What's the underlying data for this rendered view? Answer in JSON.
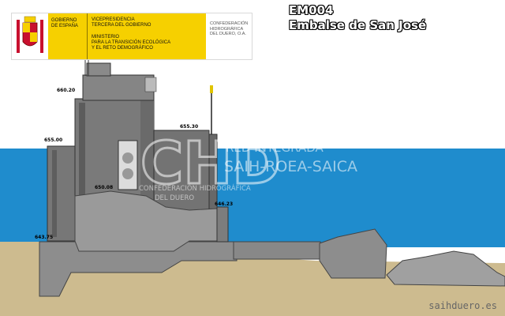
{
  "header": {
    "ministry_left_lines": [
      "GOBIERNO",
      "DE ESPAÑA"
    ],
    "ministry_right_lines_1": [
      "VICEPRESIDENCIA",
      "TERCERA DEL GOBIERNO"
    ],
    "ministry_right_lines_2": [
      "MINISTERIO",
      "PARA LA TRANSICIÓN ECOLÓGICA",
      "Y EL RETO DEMOGRÁFICO"
    ],
    "confederation_lines": [
      "CONFEDERACIÓN",
      "HIDROGRÁFICA",
      "DEL DUERO, O.A."
    ]
  },
  "station": {
    "code": "EM004",
    "name": "Embalse de San José"
  },
  "watermark": {
    "logo_letters": "CHD",
    "network": "RED INTEGRADA",
    "system": "SAIH-ROEA-SAICA",
    "org_line1": "CONFEDERACIÓN HIDROGRÁFICA",
    "org_line2": "DEL DUERO"
  },
  "levels": {
    "top": "660.20",
    "upper_left": "655.00",
    "mid_right": "655.30",
    "center": "650.08",
    "right": "646.23",
    "bottom_left": "643.75"
  },
  "footer": {
    "site": "saihduero.es"
  },
  "colors": {
    "sky": "#ffffff",
    "water": "#1f8ccd",
    "ground": "#cdbb8f",
    "concrete": "#888888",
    "building": "#777777",
    "gov_yellow": "#f6d000"
  }
}
